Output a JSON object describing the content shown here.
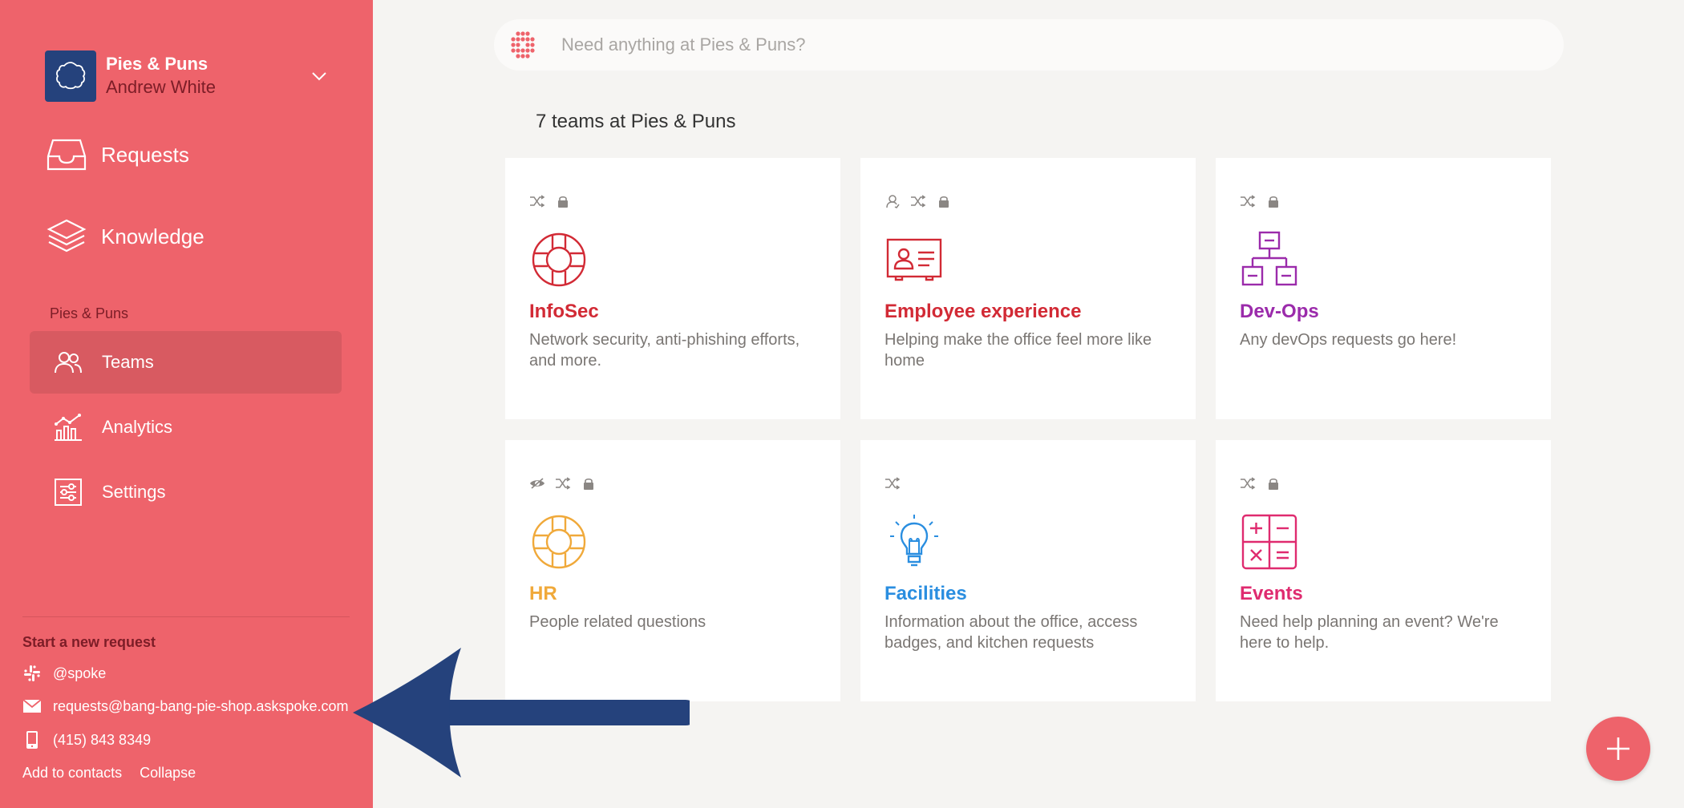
{
  "workspace": {
    "name": "Pies & Puns",
    "user": "Andrew White"
  },
  "nav": {
    "requests": "Requests",
    "knowledge": "Knowledge",
    "section_title": "Pies & Puns",
    "teams": "Teams",
    "analytics": "Analytics",
    "settings": "Settings"
  },
  "start_request": {
    "title": "Start a new request",
    "slack": "@spoke",
    "email": "requests@bang-bang-pie-shop.askspoke.com",
    "phone": "(415) 843 8349",
    "add_contacts": "Add to contacts",
    "collapse": "Collapse"
  },
  "search": {
    "placeholder": "Need anything at Pies & Puns?"
  },
  "teams_heading": "7 teams at Pies & Puns",
  "colors": {
    "sidebar": "#ee636b",
    "infosec": "#d22a35",
    "employee": "#d22a35",
    "devops": "#9b2bab",
    "hr": "#f0a93a",
    "facilities": "#2a8ee0",
    "events": "#df2b6f"
  },
  "teams": [
    {
      "name": "InfoSec",
      "desc": "Network security, anti-phishing efforts, and more.",
      "icon": "lifebuoy-icon",
      "badges": [
        "shuffle-icon",
        "lock-icon"
      ]
    },
    {
      "name": "Employee experience",
      "desc": "Helping make the office feel more like home",
      "icon": "id-card-icon",
      "badges": [
        "person-icon",
        "shuffle-icon",
        "lock-icon"
      ]
    },
    {
      "name": "Dev-Ops",
      "desc": "Any devOps requests go here!",
      "icon": "org-chart-icon",
      "badges": [
        "shuffle-icon",
        "lock-icon"
      ]
    },
    {
      "name": "HR",
      "desc": "People related questions",
      "icon": "lifebuoy-icon",
      "badges": [
        "eye-off-icon",
        "shuffle-icon",
        "lock-icon"
      ]
    },
    {
      "name": "Facilities",
      "desc": "Information about the office, access badges, and kitchen requests",
      "icon": "lightbulb-icon",
      "badges": [
        "shuffle-icon"
      ]
    },
    {
      "name": "Events",
      "desc": "Need help planning an event? We're here to help.",
      "icon": "calculator-icon",
      "badges": [
        "shuffle-icon",
        "lock-icon"
      ]
    }
  ]
}
